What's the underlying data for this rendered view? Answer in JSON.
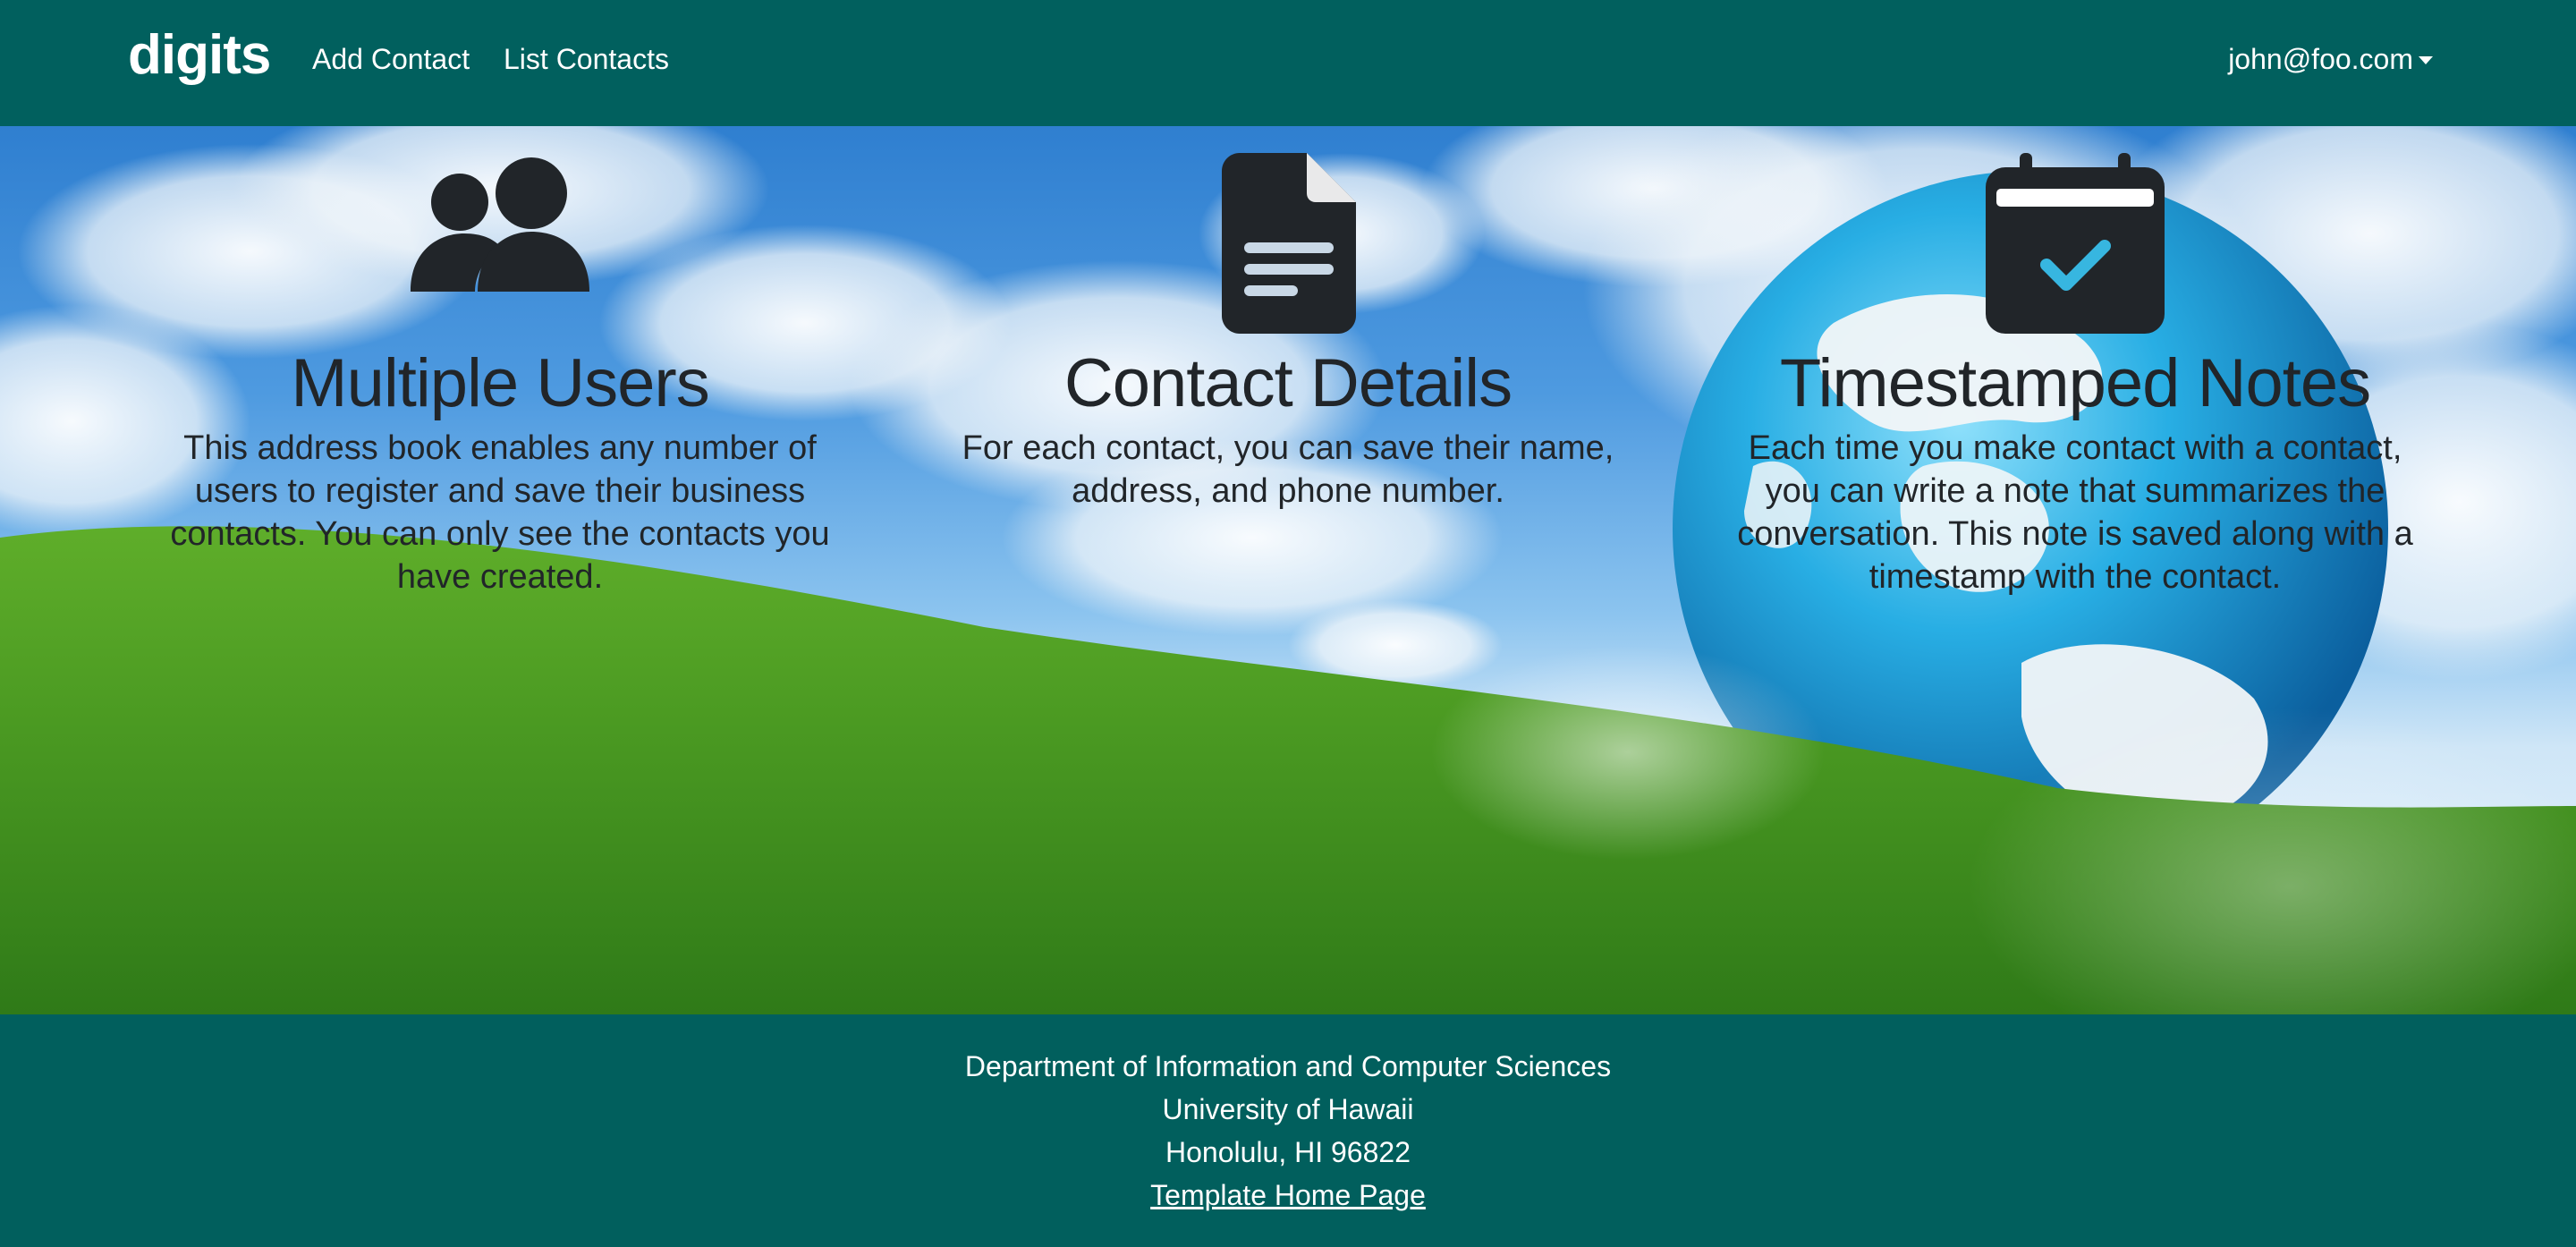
{
  "nav": {
    "brand": "digits",
    "links": [
      {
        "label": "Add Contact"
      },
      {
        "label": "List Contacts"
      }
    ],
    "user": "john@foo.com"
  },
  "features": [
    {
      "icon": "users-icon",
      "title": "Multiple Users",
      "text": "This address book enables any number of users to register and save their business contacts. You can only see the contacts you have created."
    },
    {
      "icon": "file-icon",
      "title": "Contact Details",
      "text": "For each contact, you can save their name, address, and phone number."
    },
    {
      "icon": "calendar-check-icon",
      "title": "Timestamped Notes",
      "text": "Each time you make contact with a contact, you can write a note that summarizes the conversation. This note is saved along with a timestamp with the contact."
    }
  ],
  "footer": {
    "lines": [
      "Department of Information and Computer Sciences",
      "University of Hawaii",
      "Honolulu, HI 96822"
    ],
    "link": "Template Home Page"
  },
  "colors": {
    "primary": "#01605e",
    "text_dark": "#212529",
    "grass": "#4f9a24"
  }
}
